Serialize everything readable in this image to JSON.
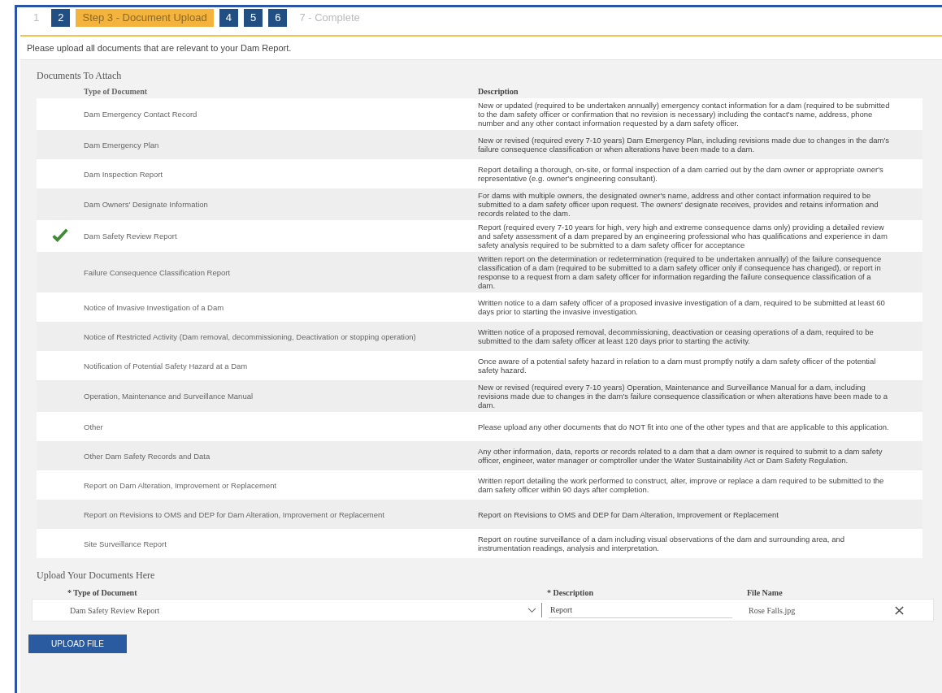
{
  "steps": [
    {
      "label": "1",
      "kind": "plain",
      "selected": false
    },
    {
      "label": "2",
      "kind": "link",
      "selected": false
    },
    {
      "label": "Step 3 - Document Upload",
      "kind": "link",
      "selected": true
    },
    {
      "label": "4",
      "kind": "link",
      "selected": false
    },
    {
      "label": "5",
      "kind": "link",
      "selected": false
    },
    {
      "label": "6",
      "kind": "link",
      "selected": false
    },
    {
      "label": "7 - Complete",
      "kind": "plain",
      "selected": false
    }
  ],
  "intro": "Please upload all documents that are relevant to your Dam Report.",
  "documents": {
    "title": "Documents To Attach",
    "columns": [
      "Type of Document",
      "Description"
    ],
    "rows": [
      {
        "type": "Dam Emergency Contact Record",
        "checked": false,
        "description": "New or updated (required to be undertaken annually) emergency contact information for a dam (required to be submitted to the dam safety officer or confirmation that no revision is necessary) including the contact's name, address, phone number and any other contact information requested by a dam safety officer."
      },
      {
        "type": "Dam Emergency Plan",
        "checked": false,
        "description": "New or revised (required every 7-10 years) Dam Emergency Plan, including revisions made due to changes in the dam's failure consequence classification or when alterations have been made to a dam."
      },
      {
        "type": "Dam Inspection Report",
        "checked": false,
        "description": "Report detailing a thorough, on-site, or formal inspection of a dam carried out by the dam owner or appropriate owner's representative (e.g. owner's engineering consultant)."
      },
      {
        "type": "Dam Owners' Designate Information",
        "checked": false,
        "description": "For dams with multiple owners, the designated owner's name, address and other contact information required to be submitted to a dam safety officer upon request. The owners' designate receives, provides and retains information and records related to the dam."
      },
      {
        "type": "Dam Safety Review Report",
        "checked": true,
        "description": "Report (required every 7-10 years for high, very high and extreme consequence dams only) providing a detailed review and safety assessment of a dam prepared by an engineering professional who has qualifications and experience in dam safety analysis required to be submitted to a dam safety officer for acceptance"
      },
      {
        "type": "Failure Consequence Classification Report",
        "checked": false,
        "description": "Written report on the determination or redetermination (required to be undertaken annually) of the failure consequence classification of a dam (required to be submitted to a dam safety officer only if consequence has changed), or report in response to a request from a dam safety officer for information regarding the failure consequence classification of a dam."
      },
      {
        "type": "Notice of Invasive Investigation of a Dam",
        "checked": false,
        "description": "Written notice to a dam safety officer of a proposed invasive investigation of a dam, required to be submitted at least 60 days prior to starting the invasive investigation."
      },
      {
        "type": "Notice of Restricted Activity (Dam removal, decommissioning, Deactivation or stopping operation)",
        "checked": false,
        "description": "Written notice of a proposed removal, decommissioning, deactivation or ceasing operations of a dam, required to be submitted to the dam safety officer at least 120 days prior to starting the activity."
      },
      {
        "type": "Notification of Potential Safety Hazard at a Dam",
        "checked": false,
        "description": "Once aware of a potential safety hazard in relation to a dam must promptly notify a dam safety officer of the potential safety hazard."
      },
      {
        "type": "Operation, Maintenance and Surveillance Manual",
        "checked": false,
        "description": "New or revised (required every 7-10 years) Operation, Maintenance and Surveillance Manual for a dam, including revisions made due to changes in the dam's failure consequence classification or when alterations have been made to a dam."
      },
      {
        "type": "Other",
        "checked": false,
        "description": "Please upload any other documents that do NOT fit into one of the other types and that are applicable to this application."
      },
      {
        "type": "Other Dam Safety Records and Data",
        "checked": false,
        "description": "Any other information, data, reports or records related to a dam that a dam owner is required to submit to a dam safety officer, engineer, water manager or comptroller under the Water Sustainability Act or Dam Safety Regulation."
      },
      {
        "type": "Report on Dam Alteration, Improvement or Replacement",
        "checked": false,
        "description": "Written report detailing the work performed to construct, alter, improve or replace a dam required to be submitted to the dam safety officer within 90 days after completion."
      },
      {
        "type": "Report on Revisions to OMS and DEP for Dam Alteration, Improvement or Replacement",
        "checked": false,
        "description": "Report on Revisions to OMS and DEP for Dam Alteration, Improvement or Replacement"
      },
      {
        "type": "Site Surveillance Report",
        "checked": false,
        "description": "Report on routine surveillance of a dam including visual observations of the dam and surrounding area, and instrumentation readings, analysis and interpretation."
      }
    ]
  },
  "upload": {
    "title": "Upload Your Documents Here",
    "type_label": "* Type of Document",
    "description_label": "* Description",
    "file_label": "File Name",
    "type_value": "Dam Safety Review Report",
    "description_value": "Report",
    "file_name": "Rose Falls.jpg",
    "button": "UPLOAD FILE"
  }
}
